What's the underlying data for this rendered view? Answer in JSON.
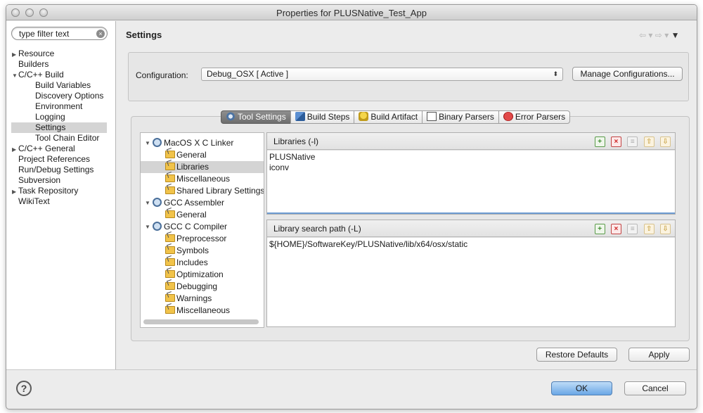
{
  "window": {
    "title": "Properties for PLUSNative_Test_App"
  },
  "filter": {
    "placeholder": "type filter text",
    "value": "type filter text",
    "clear_glyph": "×"
  },
  "nav": {
    "items": [
      {
        "label": "Resource",
        "indent": 0,
        "expander": "▶"
      },
      {
        "label": "Builders",
        "indent": 0,
        "expander": ""
      },
      {
        "label": "C/C++ Build",
        "indent": 0,
        "expander": "▼"
      },
      {
        "label": "Build Variables",
        "indent": 1,
        "expander": ""
      },
      {
        "label": "Discovery Options",
        "indent": 1,
        "expander": ""
      },
      {
        "label": "Environment",
        "indent": 1,
        "expander": ""
      },
      {
        "label": "Logging",
        "indent": 1,
        "expander": ""
      },
      {
        "label": "Settings",
        "indent": 1,
        "expander": "",
        "selected": true
      },
      {
        "label": "Tool Chain Editor",
        "indent": 1,
        "expander": ""
      },
      {
        "label": "C/C++ General",
        "indent": 0,
        "expander": "▶"
      },
      {
        "label": "Project References",
        "indent": 0,
        "expander": ""
      },
      {
        "label": "Run/Debug Settings",
        "indent": 0,
        "expander": ""
      },
      {
        "label": "Subversion",
        "indent": 0,
        "expander": ""
      },
      {
        "label": "Task Repository",
        "indent": 0,
        "expander": "▶"
      },
      {
        "label": "WikiText",
        "indent": 0,
        "expander": ""
      }
    ]
  },
  "page": {
    "title": "Settings",
    "back_glyph": "⇦",
    "forward_glyph": "⇨",
    "menu_glyph": "▾",
    "view_menu_glyph": "▼"
  },
  "configuration": {
    "label": "Configuration:",
    "selected": "Debug_OSX  [ Active ]",
    "select_arrows": "⬍",
    "manage_button": "Manage Configurations..."
  },
  "tabs": [
    {
      "label": "Tool Settings",
      "icon": "tool-settings-icon",
      "active": true
    },
    {
      "label": "Build Steps",
      "icon": "build-steps-icon"
    },
    {
      "label": "Build Artifact",
      "icon": "build-artifact-icon"
    },
    {
      "label": "Binary Parsers",
      "icon": "binary-parsers-icon"
    },
    {
      "label": "Error Parsers",
      "icon": "error-parsers-icon"
    }
  ],
  "tool_tree": [
    {
      "label": "MacOS X C Linker",
      "level": 0,
      "expander": "▼",
      "icon": "tool-gear-icon"
    },
    {
      "label": "General",
      "level": 1,
      "icon": "option-folder-icon"
    },
    {
      "label": "Libraries",
      "level": 1,
      "icon": "option-folder-icon",
      "selected": true
    },
    {
      "label": "Miscellaneous",
      "level": 1,
      "icon": "option-folder-icon"
    },
    {
      "label": "Shared Library Settings",
      "level": 1,
      "icon": "option-folder-icon"
    },
    {
      "label": "GCC Assembler",
      "level": 0,
      "expander": "▼",
      "icon": "tool-gear-icon"
    },
    {
      "label": "General",
      "level": 1,
      "icon": "option-folder-icon"
    },
    {
      "label": "GCC C Compiler",
      "level": 0,
      "expander": "▼",
      "icon": "tool-gear-icon"
    },
    {
      "label": "Preprocessor",
      "level": 1,
      "icon": "option-folder-icon"
    },
    {
      "label": "Symbols",
      "level": 1,
      "icon": "option-folder-icon"
    },
    {
      "label": "Includes",
      "level": 1,
      "icon": "option-folder-icon"
    },
    {
      "label": "Optimization",
      "level": 1,
      "icon": "option-folder-icon"
    },
    {
      "label": "Debugging",
      "level": 1,
      "icon": "option-folder-icon"
    },
    {
      "label": "Warnings",
      "level": 1,
      "icon": "option-folder-icon"
    },
    {
      "label": "Miscellaneous",
      "level": 1,
      "icon": "option-folder-icon"
    }
  ],
  "libraries": {
    "title": "Libraries (-l)",
    "items": [
      "PLUSNative",
      "iconv"
    ]
  },
  "library_paths": {
    "title": "Library search path (-L)",
    "items": [
      "${HOME}/SoftwareKey/PLUSNative/lib/x64/osx/static"
    ]
  },
  "list_toolbar": {
    "add_glyph": "+",
    "delete_glyph": "×",
    "edit_glyph": "≡",
    "up_glyph": "⇧",
    "down_glyph": "⇩"
  },
  "buttons": {
    "restore_defaults": "Restore Defaults",
    "apply": "Apply",
    "ok": "OK",
    "cancel": "Cancel",
    "help_glyph": "?"
  }
}
